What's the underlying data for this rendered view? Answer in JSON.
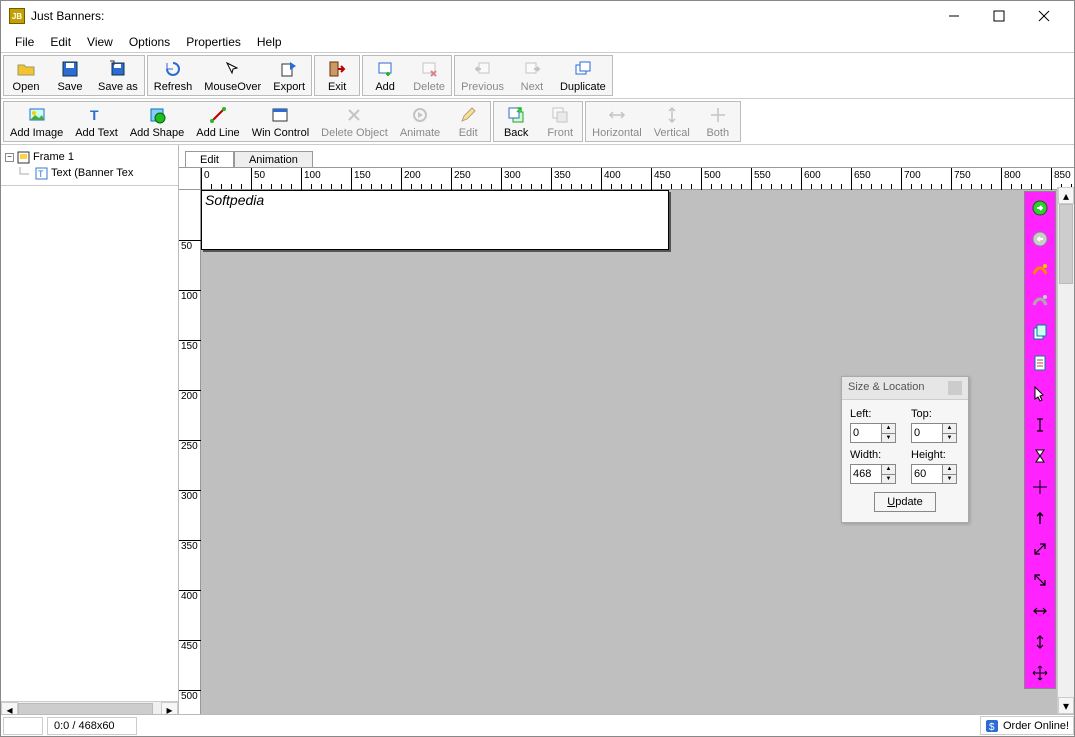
{
  "window": {
    "title": "Just Banners:"
  },
  "menubar": [
    "File",
    "Edit",
    "View",
    "Options",
    "Properties",
    "Help"
  ],
  "toolbar1": [
    {
      "label": "Open",
      "icon": "folder",
      "enabled": true
    },
    {
      "label": "Save",
      "icon": "save",
      "enabled": true
    },
    {
      "label": "Save as",
      "icon": "saveas",
      "enabled": true
    },
    {
      "label": "Refresh",
      "icon": "refresh",
      "enabled": true
    },
    {
      "label": "MouseOver",
      "icon": "mouseover",
      "enabled": true
    },
    {
      "label": "Export",
      "icon": "export",
      "enabled": true
    },
    {
      "label": "Exit",
      "icon": "exit",
      "enabled": true
    },
    {
      "label": "Add",
      "icon": "add",
      "enabled": true
    },
    {
      "label": "Delete",
      "icon": "delete",
      "enabled": false
    },
    {
      "label": "Previous",
      "icon": "prev",
      "enabled": false
    },
    {
      "label": "Next",
      "icon": "next",
      "enabled": false
    },
    {
      "label": "Duplicate",
      "icon": "dup",
      "enabled": true
    }
  ],
  "toolbar1_groups": [
    [
      0,
      1,
      2
    ],
    [
      3,
      4,
      5
    ],
    [
      6
    ],
    [
      7,
      8
    ],
    [
      9,
      10,
      11
    ]
  ],
  "toolbar2": [
    {
      "label": "Add Image",
      "icon": "addimage",
      "enabled": true
    },
    {
      "label": "Add Text",
      "icon": "addtext",
      "enabled": true
    },
    {
      "label": "Add Shape",
      "icon": "addshape",
      "enabled": true
    },
    {
      "label": "Add Line",
      "icon": "addline",
      "enabled": true
    },
    {
      "label": "Win Control",
      "icon": "wincontrol",
      "enabled": true
    },
    {
      "label": "Delete Object",
      "icon": "delobj",
      "enabled": false
    },
    {
      "label": "Animate",
      "icon": "animate",
      "enabled": false
    },
    {
      "label": "Edit",
      "icon": "editobj",
      "enabled": false
    },
    {
      "label": "Back",
      "icon": "back",
      "enabled": true
    },
    {
      "label": "Front",
      "icon": "front",
      "enabled": false
    },
    {
      "label": "Horizontal",
      "icon": "horiz",
      "enabled": false
    },
    {
      "label": "Vertical",
      "icon": "vert",
      "enabled": false
    },
    {
      "label": "Both",
      "icon": "both",
      "enabled": false
    }
  ],
  "toolbar2_groups": [
    [
      0,
      1,
      2,
      3,
      4,
      5,
      6,
      7
    ],
    [
      8,
      9
    ],
    [
      10,
      11,
      12
    ]
  ],
  "tree": {
    "frame_label": "Frame 1",
    "child_label": "Text (Banner Tex"
  },
  "tabs": [
    "Edit",
    "Animation"
  ],
  "active_tab": 0,
  "banner_text": "Softpedia",
  "ruler_h_marks": [
    0,
    50,
    100,
    150,
    200,
    250,
    300,
    350,
    400,
    450,
    500,
    550,
    600,
    650,
    700,
    750,
    800,
    850
  ],
  "ruler_v_marks": [
    50,
    100,
    150,
    200,
    250,
    300,
    350,
    400,
    450,
    500
  ],
  "palette": {
    "title": "Size & Location",
    "left": {
      "label": "Left:",
      "value": "0"
    },
    "top": {
      "label": "Top:",
      "value": "0"
    },
    "width": {
      "label": "Width:",
      "value": "468"
    },
    "height": {
      "label": "Height:",
      "value": "60"
    },
    "update": "Update",
    "update_hotkey": "U"
  },
  "side_tools": [
    "sphere-green",
    "sphere-gray",
    "paint-curl",
    "paint-curl-gray",
    "page-dup",
    "page-new",
    "arrow-cursor",
    "ibeam",
    "hourglass",
    "crosshair",
    "arrow-up",
    "resize-nesw",
    "resize-nwse",
    "resize-we",
    "resize-ns",
    "move-all"
  ],
  "status": {
    "coords": "0:0 / 468x60",
    "order": "Order Online!"
  }
}
